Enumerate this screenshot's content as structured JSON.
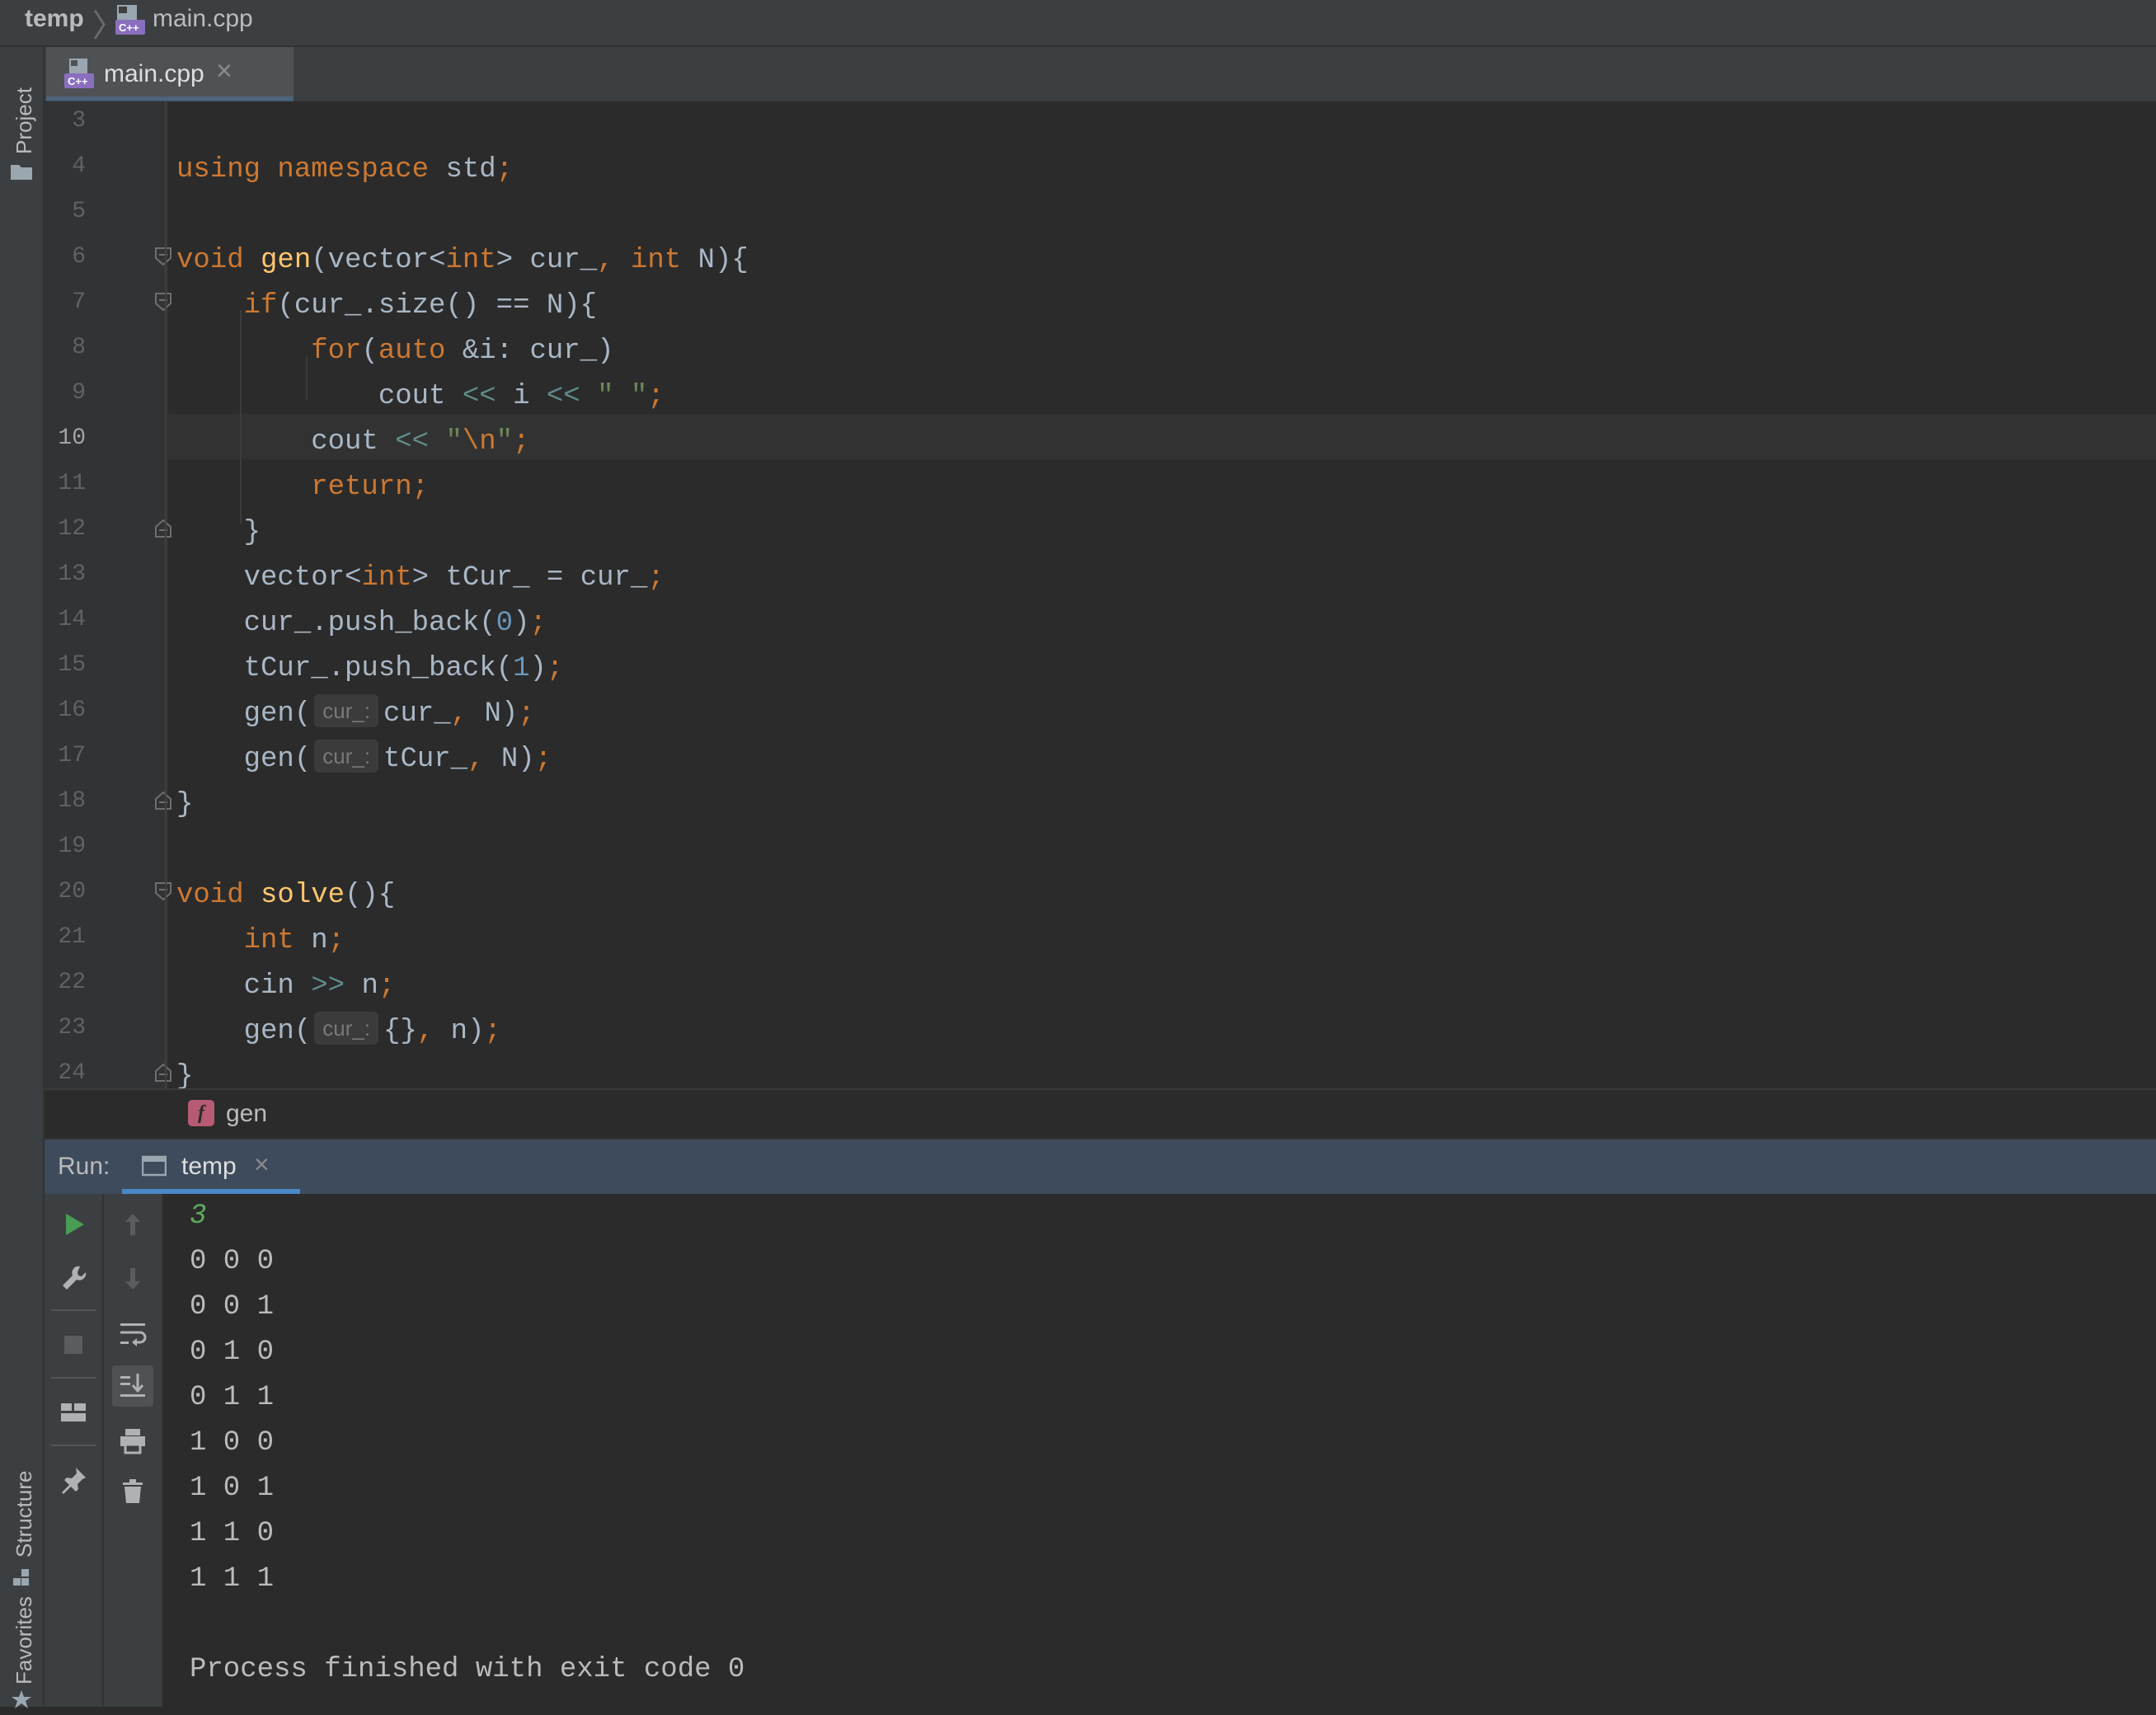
{
  "breadcrumb": {
    "project": "temp",
    "file": "main.cpp"
  },
  "sidebar": {
    "project_label": "Project",
    "structure_label": "Structure",
    "favorites_label": "Favorites"
  },
  "editor_tab": {
    "label": "main.cpp",
    "close": "×"
  },
  "editor": {
    "current_line": 10,
    "line_numbers": [
      "3",
      "4",
      "5",
      "6",
      "7",
      "8",
      "9",
      "10",
      "11",
      "12",
      "13",
      "14",
      "15",
      "16",
      "17",
      "18",
      "19",
      "20",
      "21",
      "22",
      "23",
      "24"
    ],
    "hint_label": "cur_:"
  },
  "code_breadcrumb": {
    "icon_letter": "f",
    "label": "gen"
  },
  "run": {
    "label": "Run:",
    "tab_label": "temp",
    "tab_close": "×",
    "console": {
      "input": "3",
      "output": [
        "0 0 0",
        "0 0 1",
        "0 1 0",
        "0 1 1",
        "1 0 0",
        "1 0 1",
        "1 1 0",
        "1 1 1"
      ],
      "exit_message": "Process finished with exit code 0"
    }
  },
  "colors": {
    "keyword": "#cc7832",
    "function": "#ffc66d",
    "number": "#6897bb",
    "string": "#6a8759",
    "operator": "#5f8c8a",
    "text": "#a9b7c6",
    "accent": "#4a88c7",
    "run_green": "#499c54"
  }
}
